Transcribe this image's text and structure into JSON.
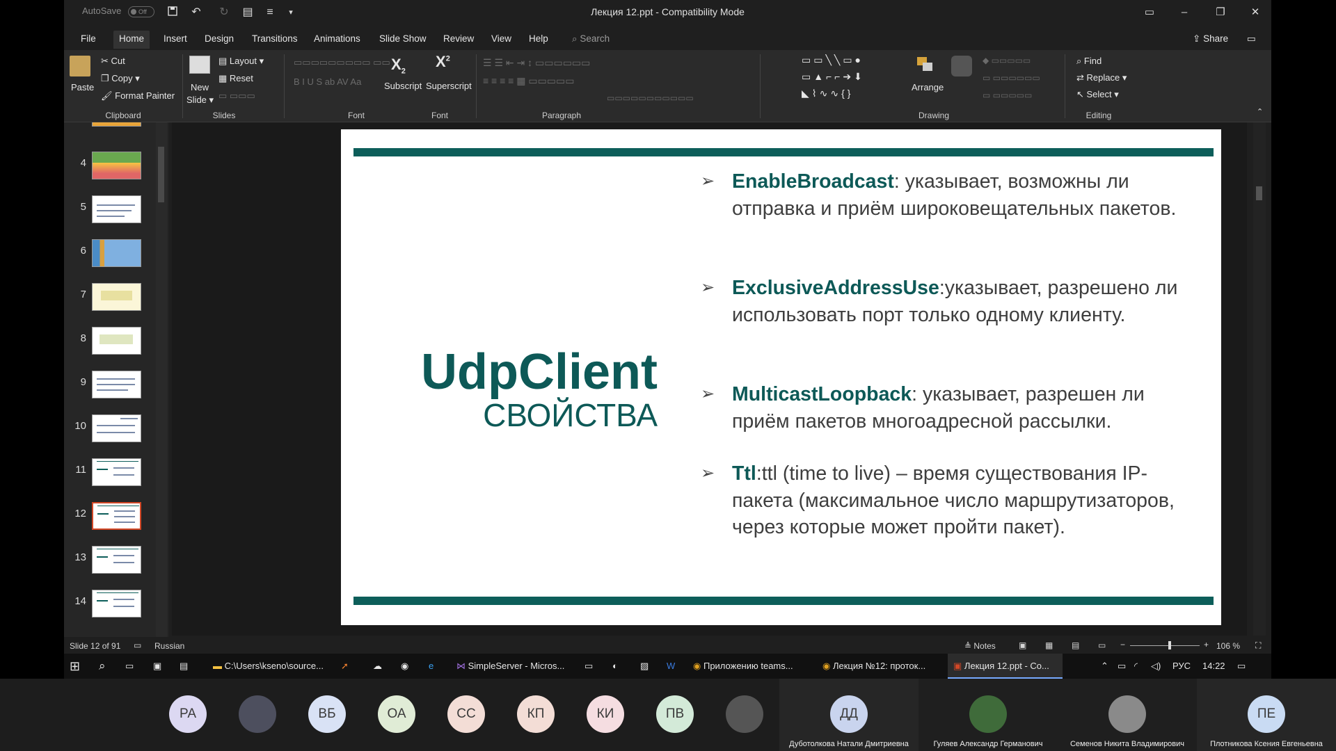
{
  "window": {
    "title": "Лекция 12.ppt  -  Compatibility Mode",
    "autosave_label": "AutoSave",
    "autosave_state": "Off",
    "share_label": "Share"
  },
  "menu_tabs": [
    "File",
    "Home",
    "Insert",
    "Design",
    "Transitions",
    "Animations",
    "Slide Show",
    "Review",
    "View",
    "Help"
  ],
  "search": {
    "placeholder": "Search"
  },
  "ribbon": {
    "clipboard": {
      "paste": "Paste",
      "cut": "Cut",
      "copy": "Copy",
      "format_painter": "Format Painter",
      "group": "Clipboard"
    },
    "slides": {
      "new_slide_1": "New",
      "new_slide_2": "Slide",
      "layout": "Layout",
      "reset": "Reset",
      "group": "Slides"
    },
    "font": {
      "group": "Font",
      "subscript": "Subscript",
      "superscript": "Superscript",
      "group2": "Font"
    },
    "paragraph": {
      "group": "Paragraph"
    },
    "drawing": {
      "arrange": "Arrange",
      "group": "Drawing"
    },
    "editing": {
      "find": "Find",
      "replace": "Replace",
      "select": "Select",
      "group": "Editing"
    }
  },
  "thumbnails": [
    "4",
    "5",
    "6",
    "7",
    "8",
    "9",
    "10",
    "11",
    "12",
    "13",
    "14"
  ],
  "selected_slide": "12",
  "slide": {
    "title": "UdpClient",
    "subtitle": "СВОЙСТВА",
    "bullets": [
      {
        "term": "EnableBroadcast",
        "text": ": указывает, возможны ли отправка и приём широковещательных пакетов."
      },
      {
        "term": "ExclusiveAddressUse",
        "text": ":указывает, разрешено ли использовать порт только одному клиенту."
      },
      {
        "term": "MulticastLoopback",
        "text": ": указывает, разрешен ли приём пакетов многоадресной рассылки."
      },
      {
        "term": "Ttl",
        "text": ":ttl (time to live) – время существования IP-пакета (максимальное число маршрутизаторов, через которые может пройти пакет)."
      }
    ],
    "accent_color": "#0d5e5a"
  },
  "status": {
    "slide_info": "Slide 12 of 91",
    "language": "Russian",
    "notes": "Notes",
    "zoom": "106 %"
  },
  "taskbar": {
    "items": [
      "C:\\Users\\kseno\\source...",
      "SimpleServer - Micros...",
      "Приложению teams...",
      "Лекция №12: проток...",
      "Лекция 12.ppt  -  Co..."
    ],
    "lang": "РУС",
    "time": "14:22"
  },
  "participants": {
    "avatars": [
      {
        "initials": "РА",
        "color": "#dcd8f2"
      },
      {
        "initials": "",
        "color": "#4d4f5e"
      },
      {
        "initials": "ВБ",
        "color": "#d9e2f5"
      },
      {
        "initials": "ОА",
        "color": "#e0ecd6"
      },
      {
        "initials": "СС",
        "color": "#f3ddd6"
      },
      {
        "initials": "КП",
        "color": "#f3ddd6"
      },
      {
        "initials": "КИ",
        "color": "#f5dde1"
      },
      {
        "initials": "ПВ",
        "color": "#d3ead8"
      },
      {
        "initials": "",
        "color": "#555"
      }
    ],
    "tiles": [
      {
        "initials": "ДД",
        "name": "Дуботолкова Натали Дмитриевна",
        "color": "#c9d4ee"
      },
      {
        "initials": "",
        "name": "Гуляев Александр Германович",
        "color": "#3f6b3a"
      },
      {
        "initials": "",
        "name": "Семенов Никита Владимирович",
        "color": "#8a8a8a"
      },
      {
        "initials": "ПЕ",
        "name": "Плотникова Ксения Евгеньевна",
        "color": "#c9dbf3"
      }
    ]
  }
}
